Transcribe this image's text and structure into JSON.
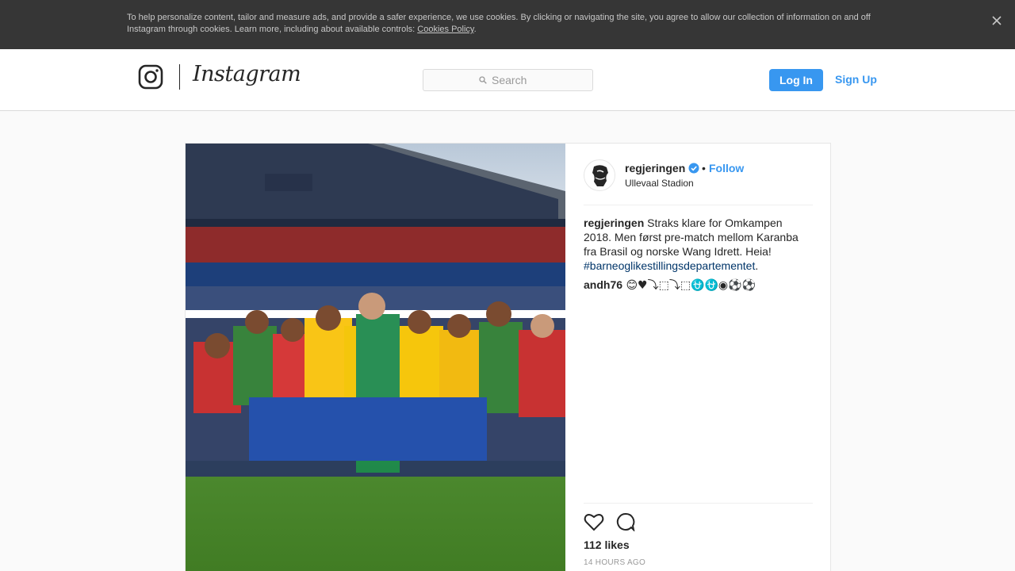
{
  "cookie_banner": {
    "text": "To help personalize content, tailor and measure ads, and provide a safer experience, we use cookies. By clicking or navigating the site, you agree to allow our collection of information on and off Instagram through cookies. Learn more, including about available controls: ",
    "link_label": "Cookies Policy",
    "trailing": ".",
    "close_icon": "close-icon"
  },
  "header": {
    "logo_word": "Instagram",
    "search_placeholder": "Search",
    "login_label": "Log In",
    "signup_label": "Sign Up"
  },
  "post": {
    "author": {
      "username": "regjeringen",
      "verified": true,
      "separator": "•",
      "follow_label": "Follow",
      "location": "Ullevaal Stadion"
    },
    "caption": {
      "username": "regjeringen",
      "text": " Straks klare for Omkampen 2018. Men først pre-match mellom Karanba fra Brasil og norske Wang Idrett. Heia! ",
      "hashtag": "#barneoglikestillingsdepartementet",
      "trailing": "."
    },
    "comment": {
      "username": "andh76",
      "text": " 😊♥⤵⬚⤵⬚⛎⛎◉⚽⚽"
    },
    "likes": "112 likes",
    "timestamp": "14 HOURS AGO"
  },
  "colors": {
    "accent": "#3897f0",
    "banner_bg": "#363636",
    "hashtag": "#003569"
  }
}
